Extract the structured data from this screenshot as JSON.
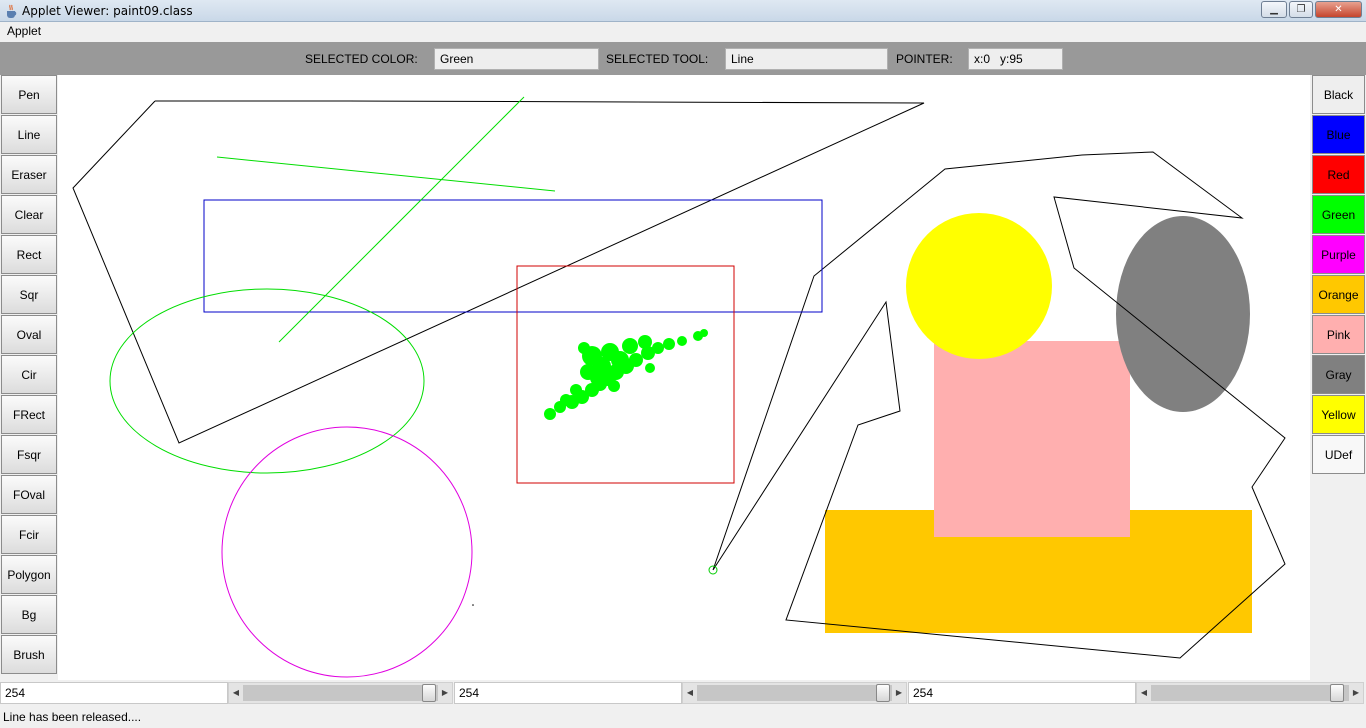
{
  "window": {
    "title": "Applet Viewer: paint09.class"
  },
  "menu": {
    "items": [
      "Applet"
    ]
  },
  "toolbar": {
    "selected_color_label": "SELECTED COLOR:",
    "selected_color_value": "Green",
    "selected_tool_label": "SELECTED TOOL:",
    "selected_tool_value": "Line",
    "pointer_label": "POINTER:",
    "pointer_value": "x:0   y:95"
  },
  "tools": [
    "Pen",
    "Line",
    "Eraser",
    "Clear",
    "Rect",
    "Sqr",
    "Oval",
    "Cir",
    "FRect",
    "Fsqr",
    "FOval",
    "Fcir",
    "Polygon",
    "Bg",
    "Brush"
  ],
  "colors": [
    {
      "label": "Black",
      "bg": "#eeeeee",
      "fg": "#000000"
    },
    {
      "label": "Blue",
      "bg": "#0000ff",
      "fg": "#000000"
    },
    {
      "label": "Red",
      "bg": "#ff0000",
      "fg": "#000000"
    },
    {
      "label": "Green",
      "bg": "#00ff00",
      "fg": "#000000"
    },
    {
      "label": "Purple",
      "bg": "#ff00ff",
      "fg": "#000000"
    },
    {
      "label": "Orange",
      "bg": "#ffc800",
      "fg": "#000000"
    },
    {
      "label": "Pink",
      "bg": "#ffafaf",
      "fg": "#000000"
    },
    {
      "label": "Gray",
      "bg": "#808080",
      "fg": "#000000"
    },
    {
      "label": "Yellow",
      "bg": "#ffff00",
      "fg": "#000000"
    },
    {
      "label": "UDef",
      "bg": "#f8f8f8",
      "fg": "#000000"
    }
  ],
  "rgb_sliders": [
    {
      "value": "254"
    },
    {
      "value": "254"
    },
    {
      "value": "254"
    }
  ],
  "status": "Line has been released....",
  "canvas_colors": {
    "black": "#000000",
    "blue": "#0000c8",
    "red": "#d00000",
    "green": "#00ff00",
    "magenta": "#e000e0",
    "yellow": "#ffff00",
    "pink": "#ffafaf",
    "gray": "#808080",
    "orange": "#ffc800"
  }
}
